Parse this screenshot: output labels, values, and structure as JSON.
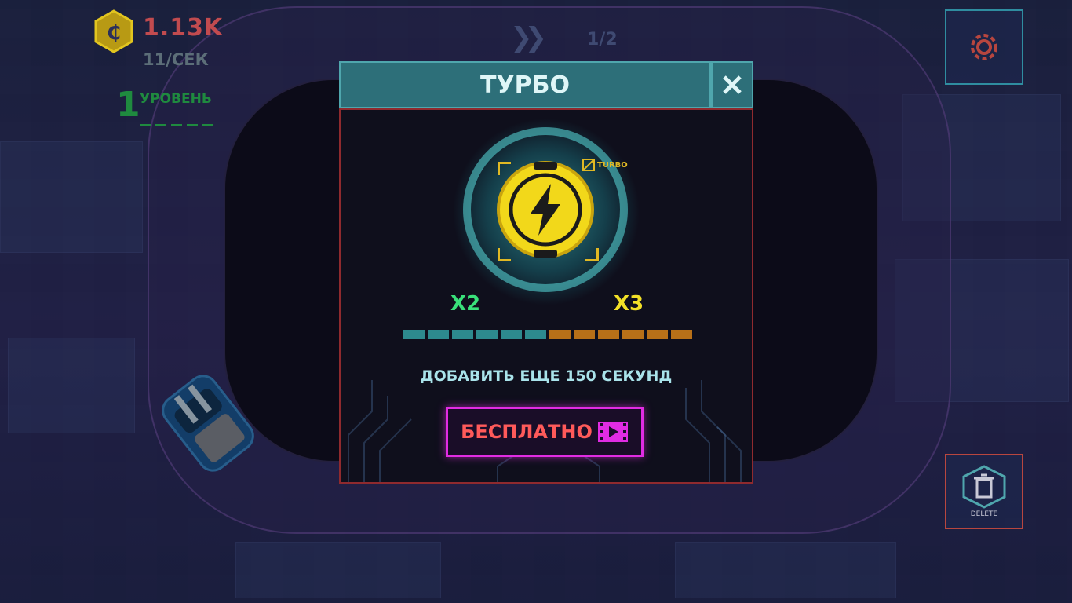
{
  "hud": {
    "coins": "1.13K",
    "rate": "11/СЕК",
    "level_number": "1",
    "level_label": "УРОВЕНЬ",
    "track_count": "1/2"
  },
  "modal": {
    "title": "ТУРБО",
    "turbo_tag": "TURBO",
    "multiplier_current": "X2",
    "multiplier_next": "X3",
    "progress": {
      "filled_segments": 6,
      "total_segments": 12
    },
    "add_text": "ДОБАВИТЬ ЕЩЕ 150 СЕКУНД",
    "free_button": "БЕСПЛАТНО"
  },
  "delete_label": "DELETE",
  "colors": {
    "coin_text": "#c24b4f",
    "level_green": "#1f8a3f",
    "header_teal": "#2d6f79",
    "progress_teal": "#2d8a8e",
    "progress_orange": "#b87018",
    "button_magenta": "#e12ce3",
    "turbo_yellow": "#f2e027"
  },
  "icons": {
    "currency": "coin-icon",
    "settings": "gear-icon",
    "delete": "trash-icon",
    "close": "close-icon",
    "turbo": "lightning-icon",
    "video": "video-ad-icon"
  }
}
